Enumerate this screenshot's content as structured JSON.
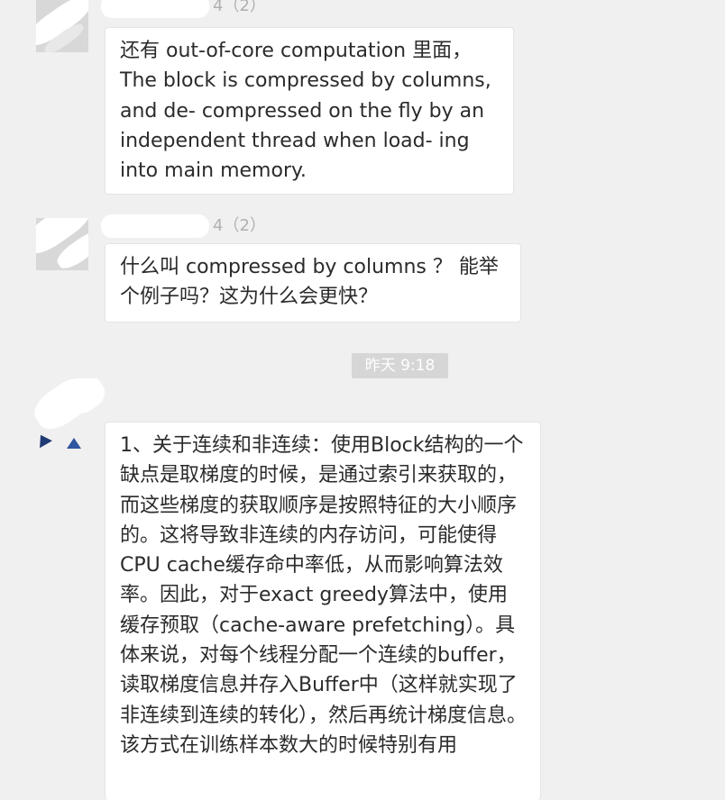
{
  "chat": {
    "messages": [
      {
        "sender_visible": "4（2）",
        "text": "还有 out-of-core computation 里面，The block is compressed by columns, and de- compressed on the fly by an independent thread when load- ing into main memory."
      },
      {
        "sender_visible": "4（2）",
        "text": "什么叫 compressed by columns ？ 能举个例子吗？这为什么会更快？"
      },
      {
        "text": "1、关于连续和非连续：使用Block结构的一个缺点是取梯度的时候，是通过索引来获取的，而这些梯度的获取顺序是按照特征的大小顺序的。这将导致非连续的内存访问，可能使得CPU cache缓存命中率低，从而影响算法效率。因此，对于exact greedy算法中，使用缓存预取（cache-aware prefetching）。具体来说，对每个线程分配一个连续的buffer，读取梯度信息并存入Buffer中（这样就实现了非连续到连续的转化），然后再统计梯度信息。该方式在训练样本数大的时候特别有用"
      }
    ],
    "timestamp": "昨天 9:18"
  },
  "colors": {
    "background": "#f0f0f0",
    "bubble": "#ffffff",
    "timestamp_bg": "#d6d6d6",
    "avatar_accent": "#1f3b73"
  }
}
